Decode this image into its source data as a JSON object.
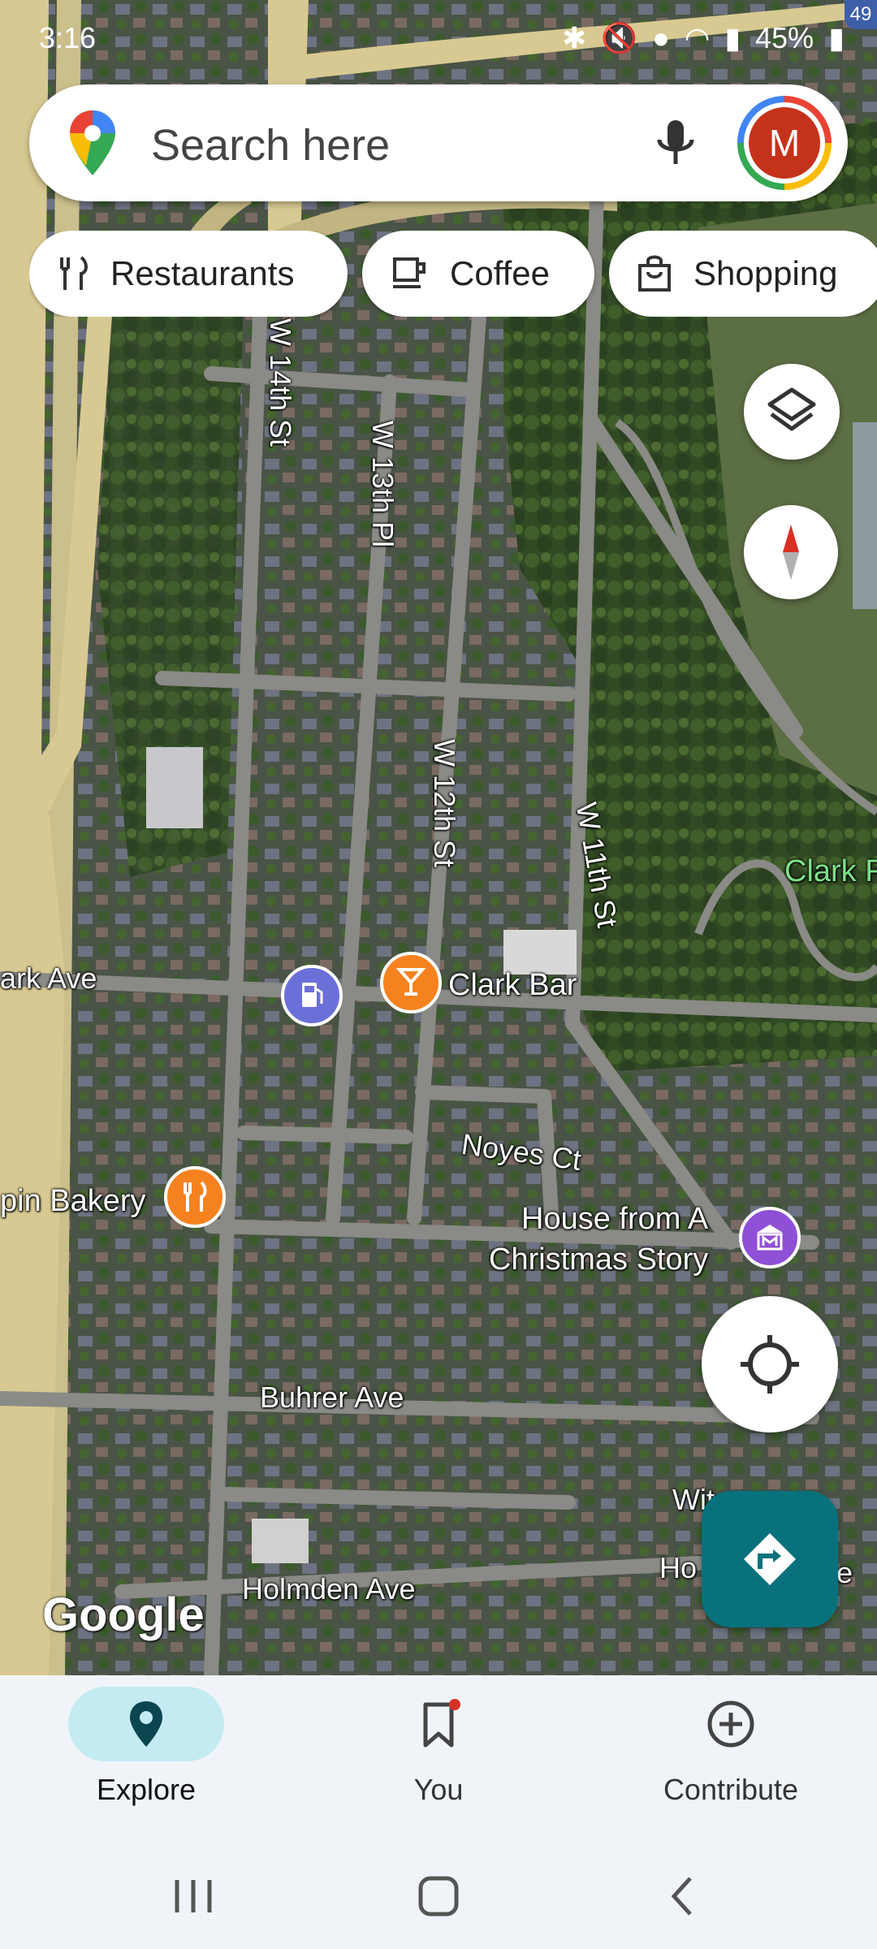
{
  "status_bar": {
    "time": "3:16",
    "battery": "45%",
    "corner_badge": "49"
  },
  "search": {
    "placeholder": "Search here",
    "avatar_initial": "M"
  },
  "chips": [
    {
      "label": "Restaurants",
      "icon": "fork-knife-icon"
    },
    {
      "label": "Coffee",
      "icon": "coffee-cup-icon"
    },
    {
      "label": "Shopping",
      "icon": "shopping-bag-icon"
    }
  ],
  "map": {
    "streets": {
      "w14": "W 14th St",
      "w13pl": "W 13th Pl",
      "w12": "W 12th St",
      "w11": "W 11th St",
      "clark_ave": "ark Ave",
      "noyes": "Noyes Ct",
      "buhrer": "Buhrer Ave",
      "holmden": "Holmden Ave",
      "witt": "Wit",
      "hol_right": "Ho",
      "hol_end": "e"
    },
    "area": {
      "clark_park": "Clark F"
    },
    "pois": {
      "clark_bar": "Clark Bar",
      "bakery": "pin Bakery",
      "christmas_line1": "House from A",
      "christmas_line2": "Christmas Story"
    },
    "attribution": "Google"
  },
  "bottom_nav": {
    "explore": "Explore",
    "you": "You",
    "contribute": "Contribute"
  },
  "colors": {
    "accent": "#08727c",
    "active_pill": "#c4eaf2",
    "poi_orange": "#f5821f",
    "poi_purple": "#8f4fd6",
    "gas_blue": "#6b6fd8",
    "avatar_bg": "#c5321b"
  }
}
